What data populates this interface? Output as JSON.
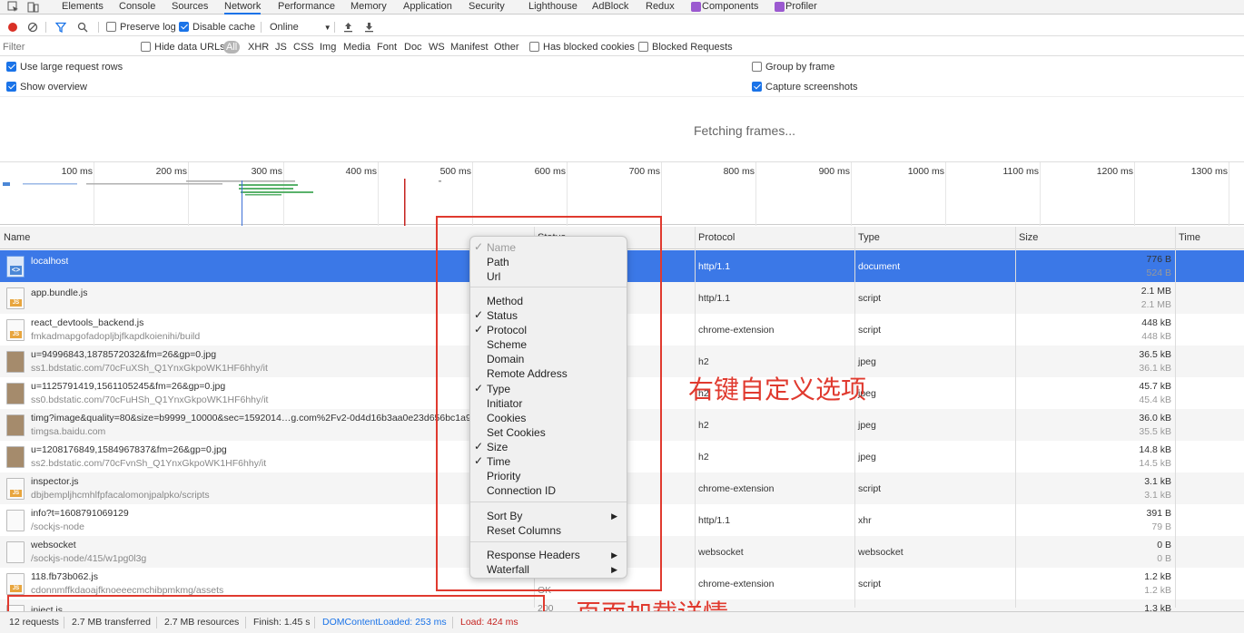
{
  "tabs": [
    {
      "label": "Elements"
    },
    {
      "label": "Console"
    },
    {
      "label": "Sources"
    },
    {
      "label": "Network"
    },
    {
      "label": "Performance"
    },
    {
      "label": "Memory"
    },
    {
      "label": "Application"
    },
    {
      "label": "Security"
    },
    {
      "label": "Lighthouse"
    },
    {
      "label": "AdBlock"
    },
    {
      "label": "Redux"
    },
    {
      "label": "Components"
    },
    {
      "label": "Profiler"
    }
  ],
  "toolbar": {
    "preserve_log": "Preserve log",
    "disable_cache": "Disable cache",
    "throttle": "Online"
  },
  "filter": {
    "placeholder": "Filter",
    "hide_data_urls": "Hide data URLs",
    "types": [
      "All",
      "XHR",
      "JS",
      "CSS",
      "Img",
      "Media",
      "Font",
      "Doc",
      "WS",
      "Manifest",
      "Other"
    ],
    "blocked_cookies": "Has blocked cookies",
    "blocked_requests": "Blocked Requests"
  },
  "settings": {
    "large_rows": "Use large request rows",
    "show_overview": "Show overview",
    "group_by_frame": "Group by frame",
    "capture_screenshots": "Capture screenshots"
  },
  "frames": {
    "fetching": "Fetching frames..."
  },
  "overview_ticks": [
    "100 ms",
    "200 ms",
    "300 ms",
    "400 ms",
    "500 ms",
    "600 ms",
    "700 ms",
    "800 ms",
    "900 ms",
    "1000 ms",
    "1100 ms",
    "1200 ms",
    "1300 ms"
  ],
  "columns": {
    "name": "Name",
    "status": "Status",
    "protocol": "Protocol",
    "type": "Type",
    "size": "Size",
    "time": "Time"
  },
  "rows": [
    {
      "icon": "html",
      "name": "localhost",
      "path": "",
      "protocol": "http/1.1",
      "type": "document",
      "size": "776 B",
      "resource": "524 B",
      "status": ""
    },
    {
      "icon": "JS",
      "name": "app.bundle.js",
      "path": "",
      "protocol": "http/1.1",
      "type": "script",
      "size": "2.1 MB",
      "resource": "2.1 MB",
      "status": ""
    },
    {
      "icon": "JS",
      "name": "react_devtools_backend.js",
      "path": "fmkadmapgofadopljbjfkapdkoienihi/build",
      "protocol": "chrome-extension",
      "type": "script",
      "size": "448 kB",
      "resource": "448 kB",
      "status": ""
    },
    {
      "icon": "img",
      "name": "u=94996843,1878572032&fm=26&gp=0.jpg",
      "path": "ss1.bdstatic.com/70cFuXSh_Q1YnxGkpoWK1HF6hhy/it",
      "protocol": "h2",
      "type": "jpeg",
      "size": "36.5 kB",
      "resource": "36.1 kB",
      "status": ""
    },
    {
      "icon": "img",
      "name": "u=1125791419,1561105245&fm=26&gp=0.jpg",
      "path": "ss0.bdstatic.com/70cFuHSh_Q1YnxGkpoWK1HF6hhy/it",
      "protocol": "h2",
      "type": "jpeg",
      "size": "45.7 kB",
      "resource": "45.4 kB",
      "status": ""
    },
    {
      "icon": "img",
      "name": "timg?image&quality=80&size=b9999_10000&sec=1592014…g.com%2Fv2-0d4d16b3aa0e23d656bc1a94",
      "path": "timgsa.baidu.com",
      "protocol": "h2",
      "type": "jpeg",
      "size": "36.0 kB",
      "resource": "35.5 kB",
      "status": ""
    },
    {
      "icon": "img",
      "name": "u=1208176849,1584967837&fm=26&gp=0.jpg",
      "path": "ss2.bdstatic.com/70cFvnSh_Q1YnxGkpoWK1HF6hhy/it",
      "protocol": "h2",
      "type": "jpeg",
      "size": "14.8 kB",
      "resource": "14.5 kB",
      "status": ""
    },
    {
      "icon": "JS",
      "name": "inspector.js",
      "path": "dbjbempljhcmhlfpfacalomonjpalpko/scripts",
      "protocol": "chrome-extension",
      "type": "script",
      "size": "3.1 kB",
      "resource": "3.1 kB",
      "status": ""
    },
    {
      "icon": "blank",
      "name": "info?t=1608791069129",
      "path": "/sockjs-node",
      "protocol": "http/1.1",
      "type": "xhr",
      "size": "391 B",
      "resource": "79 B",
      "status": ""
    },
    {
      "icon": "blank",
      "name": "websocket",
      "path": "/sockjs-node/415/w1pg0l3g",
      "protocol": "websocket",
      "type": "websocket",
      "size": "0 B",
      "resource": "0 B",
      "status": ""
    },
    {
      "icon": "JS",
      "name": "118.fb73b062.js",
      "path": "cdonnmffkdaoajfknoeeecmchibpmkmg/assets",
      "protocol": "chrome-extension",
      "type": "script",
      "size": "1.2 kB",
      "resource": "1.2 kB",
      "status": "OK"
    },
    {
      "icon": "JS",
      "name": "inject.js",
      "path": "",
      "protocol": "",
      "type": "",
      "size": "1.3 kB",
      "resource": "",
      "status": "200"
    }
  ],
  "menu": {
    "items": [
      {
        "label": "Name",
        "checked": true,
        "disabled": true
      },
      {
        "label": "Path",
        "checked": false
      },
      {
        "label": "Url",
        "checked": false
      },
      {
        "label": "Method",
        "checked": false
      },
      {
        "label": "Status",
        "checked": true
      },
      {
        "label": "Protocol",
        "checked": true
      },
      {
        "label": "Scheme",
        "checked": false
      },
      {
        "label": "Domain",
        "checked": false
      },
      {
        "label": "Remote Address",
        "checked": false
      },
      {
        "label": "Type",
        "checked": true
      },
      {
        "label": "Initiator",
        "checked": false
      },
      {
        "label": "Cookies",
        "checked": false
      },
      {
        "label": "Set Cookies",
        "checked": false
      },
      {
        "label": "Size",
        "checked": true
      },
      {
        "label": "Time",
        "checked": true
      },
      {
        "label": "Priority",
        "checked": false
      },
      {
        "label": "Connection ID",
        "checked": false
      },
      {
        "label": "Sort By",
        "submenu": true
      },
      {
        "label": "Reset Columns"
      },
      {
        "label": "Response Headers",
        "submenu": true
      },
      {
        "label": "Waterfall",
        "submenu": true
      }
    ],
    "check": "✓",
    "arrow": "▶"
  },
  "annotations": {
    "menu_note": "右键自定义选项",
    "status_note": "页面加载详情"
  },
  "status": {
    "requests": "12 requests",
    "transferred": "2.7 MB transferred",
    "resources": "2.7 MB resources",
    "finish": "Finish: 1.45 s",
    "dcl": "DOMContentLoaded: 253 ms",
    "load": "Load: 424 ms"
  },
  "colors": {
    "accent": "#1a73e8",
    "selected_row": "#3b78e7",
    "annotation": "#e03a2f"
  }
}
